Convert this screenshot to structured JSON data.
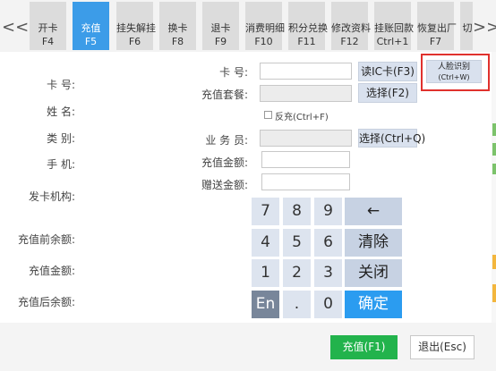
{
  "toolbar": {
    "prev_arrow": "<<",
    "next_arrow": ">>",
    "tabs": [
      {
        "label": "开卡",
        "key": "F4"
      },
      {
        "label": "充值",
        "key": "F5"
      },
      {
        "label": "挂失解挂",
        "key": "F6"
      },
      {
        "label": "换卡",
        "key": "F8"
      },
      {
        "label": "退卡",
        "key": "F9"
      },
      {
        "label": "消费明细",
        "key": "F10"
      },
      {
        "label": "积分兑换",
        "key": "F11"
      },
      {
        "label": "修改资料",
        "key": "F12"
      },
      {
        "label": "挂账回款",
        "key": "Ctrl+1"
      },
      {
        "label": "恢复出厂",
        "key": "F7"
      },
      {
        "label": "切",
        "key": ""
      }
    ]
  },
  "info": {
    "card_no": "卡 号:",
    "name": "姓 名:",
    "category": "类 别:",
    "phone": "手 机:",
    "issuer": "发卡机构:",
    "balance_before": "充值前余额:",
    "amount": "充值金额:",
    "balance_after": "充值后余额:"
  },
  "form": {
    "card_no_label": "卡 号:",
    "package_label": "充值套餐:",
    "reverse_label": "反充(Ctrl+F)",
    "salesperson_label": "业 务 员:",
    "amount_label": "充值金额:",
    "gift_label": "赠送金额:",
    "card_no_value": "",
    "package_value": "",
    "salesperson_value": "",
    "amount_value": "",
    "gift_value": ""
  },
  "buttons": {
    "read_card": "读IC卡(F3)",
    "face_line1": "人脸识别",
    "face_line2": "(Ctrl+W)",
    "select_package": "选择(F2)",
    "select_staff": "选择(Ctrl+Q)"
  },
  "keypad": {
    "keys": [
      "7",
      "8",
      "9",
      "4",
      "5",
      "6",
      "1",
      "2",
      "3",
      "En",
      ".",
      "0"
    ],
    "backspace": "←",
    "clear": "清除",
    "close": "关闭",
    "confirm": "确定"
  },
  "footer": {
    "recharge": "充值(F1)",
    "exit": "退出(Esc)"
  },
  "colors": {
    "accent": "#2b9cf0",
    "active_tab": "#3c9ce8",
    "recharge_button": "#22b34c",
    "highlight_border": "#e0312d"
  }
}
